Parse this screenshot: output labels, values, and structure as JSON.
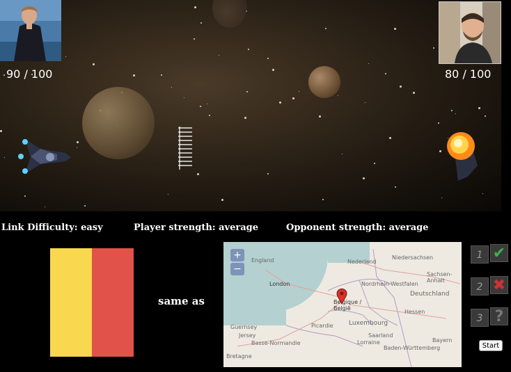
{
  "player": {
    "hp_text": "90 / 100"
  },
  "opponent": {
    "hp_text": "80 / 100"
  },
  "info": {
    "link_difficulty": "Link Difficulty: easy",
    "player_strength": "Player strength: average",
    "opponent_strength": "Opponent strength: average"
  },
  "flag": {
    "colors": [
      "#f9d84f",
      "#e0524a"
    ]
  },
  "same_as_label": "same as",
  "map": {
    "zoom_in": "+",
    "zoom_out": "−",
    "labels": [
      "England",
      "London",
      "Nederland",
      "Niedersachsen",
      "Nordrhein-Westfalen",
      "Sachsen-Anhalt",
      "Deutschland",
      "Belgique / België",
      "Luxembourg",
      "Picardie",
      "Guernsey",
      "Jersey",
      "Basse-Normandie",
      "Saarland",
      "Lorraine",
      "Bayern",
      "Baden-Württemberg",
      "Bretagne",
      "Hessen"
    ]
  },
  "choices": [
    {
      "number": "1",
      "icon": "check-icon",
      "glyph": "✔",
      "color": "#3fb14a"
    },
    {
      "number": "2",
      "icon": "cross-icon",
      "glyph": "✖",
      "color": "#cc3333"
    },
    {
      "number": "3",
      "icon": "question-icon",
      "glyph": "?",
      "color": "#777777"
    }
  ],
  "start_label": "Start"
}
